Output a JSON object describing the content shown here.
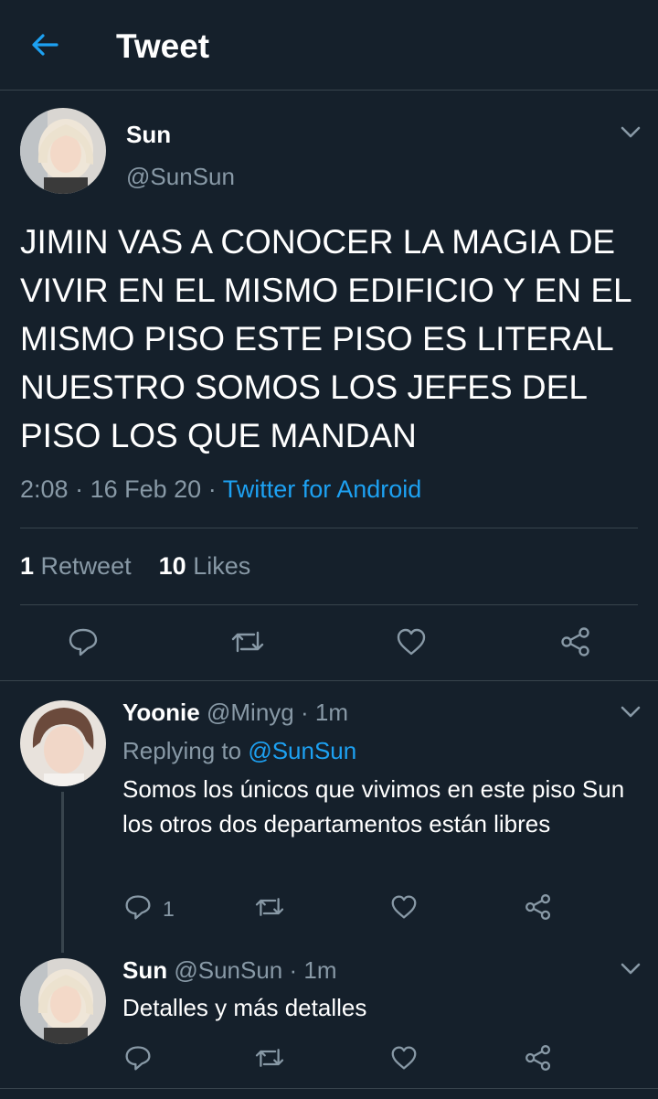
{
  "header": {
    "title": "Tweet"
  },
  "main_tweet": {
    "name": "Sun",
    "handle": "@SunSun",
    "text": "JIMIN VAS A CONOCER LA MAGIA DE VIVIR EN EL MISMO EDIFICIO Y EN EL MISMO PISO ESTE PISO ES LITERAL NUESTRO SOMOS LOS JEFES DEL PISO LOS QUE MANDAN",
    "time": "2:08",
    "date": "16 Feb 20",
    "sep": "·",
    "source": "Twitter for Android",
    "retweets_count": "1",
    "retweets_label": "Retweet",
    "likes_count": "10",
    "likes_label": "Likes",
    "actions": [
      "reply-icon",
      "retweet-icon",
      "like-icon",
      "share-icon"
    ]
  },
  "replies": [
    {
      "name": "Yoonie",
      "handle": "@Minyg",
      "time": "1m",
      "replying_prefix": "Replying to",
      "replying_to": "@SunSun",
      "text": "Somos los únicos que vivimos en este piso Sun los otros dos departamentos están libres",
      "reply_count": "1"
    },
    {
      "name": "Sun",
      "handle": "@SunSun",
      "time": "1m",
      "text": "Detalles y más detalles"
    }
  ],
  "colors": {
    "background": "#15202b",
    "accent": "#1da1f2",
    "muted": "#8899a6",
    "divider": "#38444d"
  }
}
